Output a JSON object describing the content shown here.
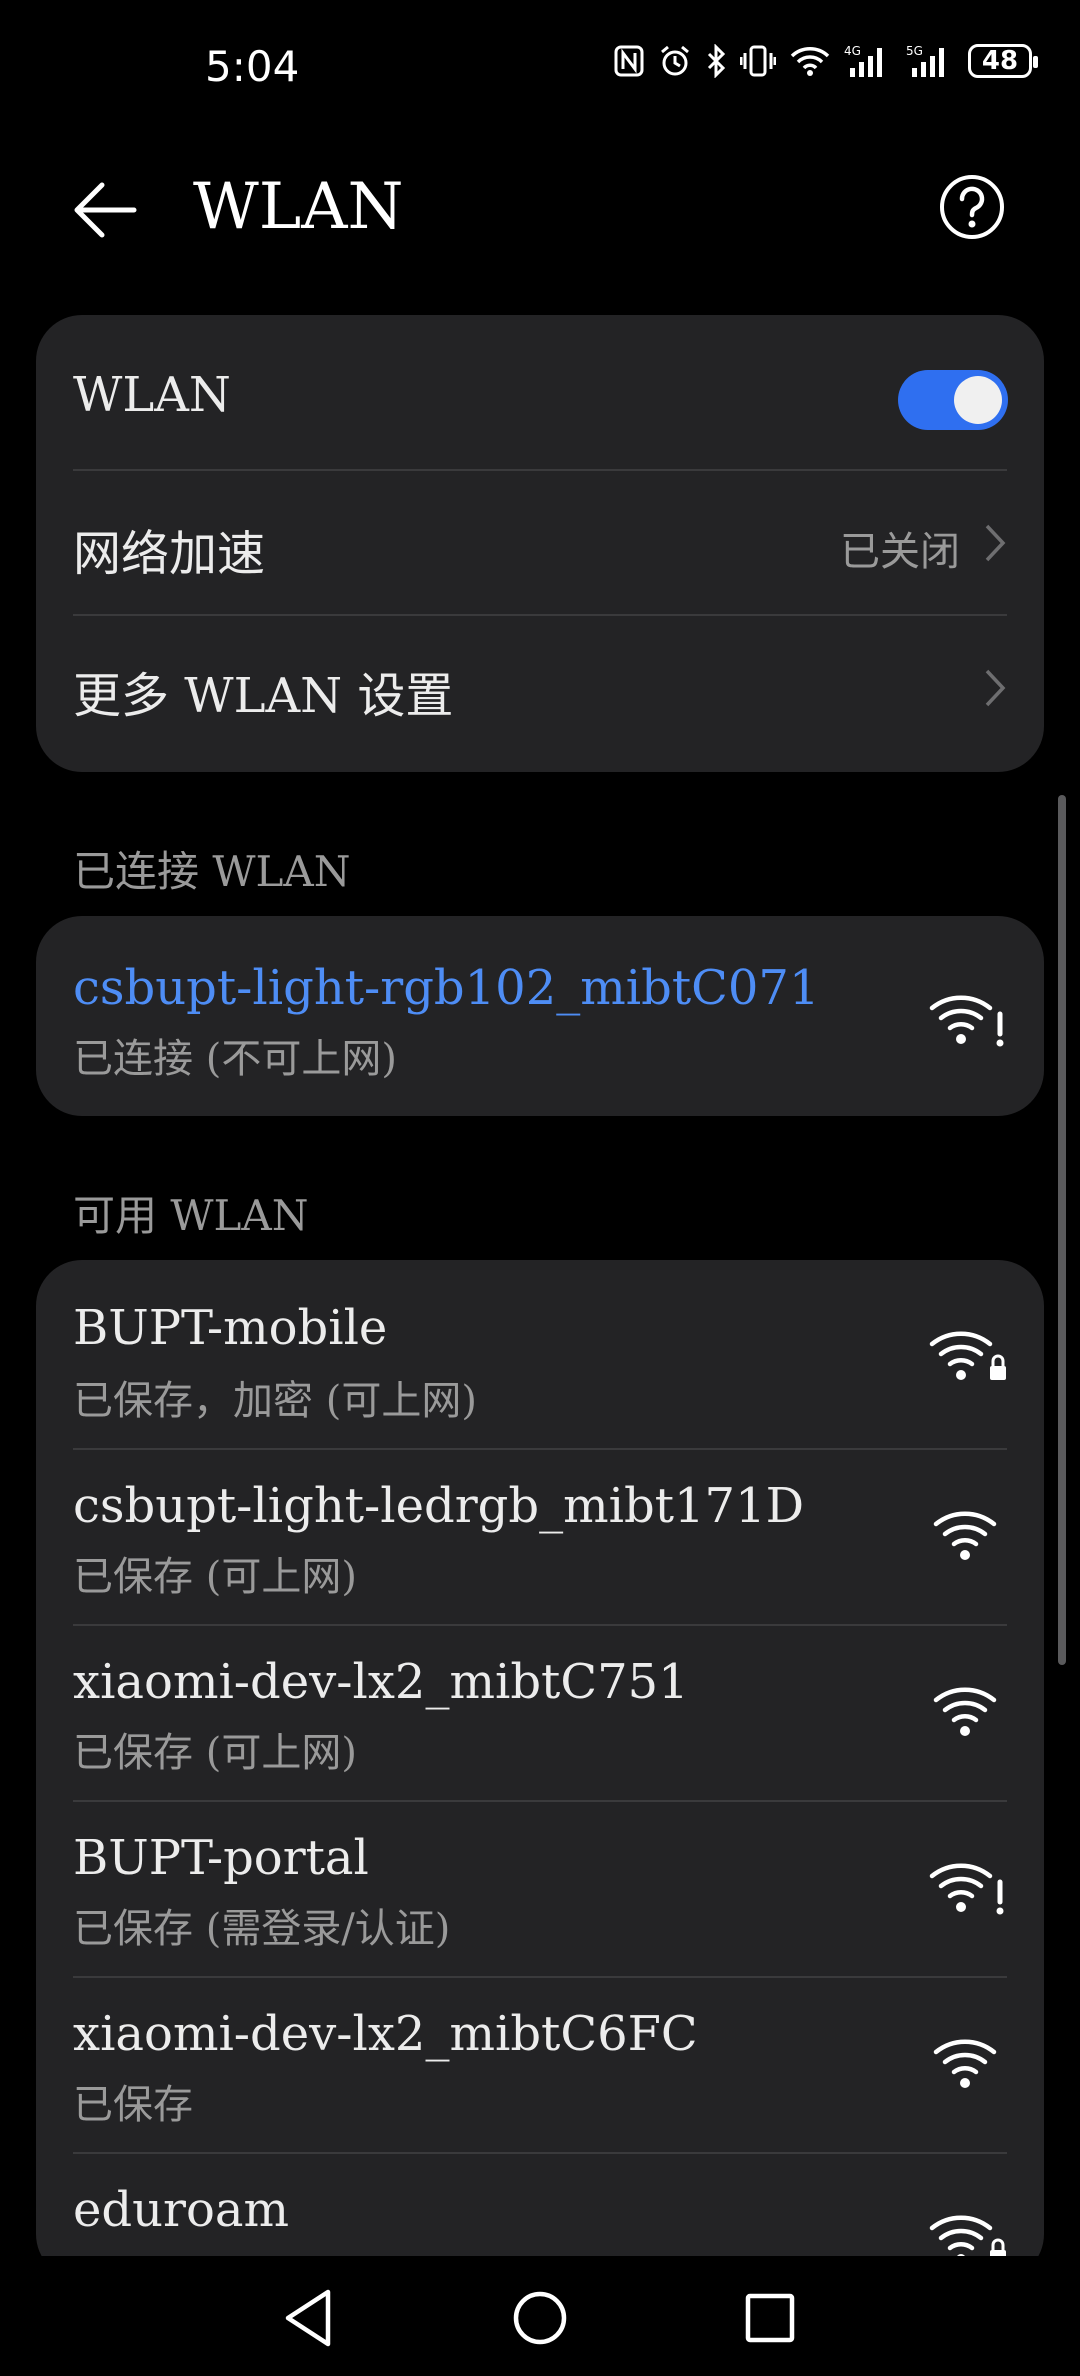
{
  "status": {
    "time": "5:04",
    "battery": "48",
    "icons": [
      "nfc-icon",
      "alarm-icon",
      "bluetooth-icon",
      "vibrate-icon",
      "wifi-icon",
      "signal-4g-icon",
      "signal-5g-icon"
    ]
  },
  "header": {
    "title": "WLAN",
    "back_icon": "back-arrow-icon",
    "help_icon": "help-icon"
  },
  "settings": {
    "wlan_label": "WLAN",
    "wlan_on": true,
    "accel_label": "网络加速",
    "accel_value": "已关闭",
    "more_label": "更多 WLAN 设置"
  },
  "connected": {
    "section_label": "已连接 WLAN",
    "name": "csbupt-light-rgb102_mibtC071",
    "status": "已连接 (不可上网)",
    "name_color": "#4e8df5"
  },
  "available": {
    "section_label": "可用 WLAN",
    "networks": [
      {
        "name": "BUPT-mobile",
        "status": "已保存，加密 (可上网)",
        "icon": "wifi-lock-icon"
      },
      {
        "name": "csbupt-light-ledrgb_mibt171D",
        "status": "已保存 (可上网)",
        "icon": "wifi-icon"
      },
      {
        "name": "xiaomi-dev-lx2_mibtC751",
        "status": "已保存 (可上网)",
        "icon": "wifi-icon"
      },
      {
        "name": "BUPT-portal",
        "status": "已保存 (需登录/认证)",
        "icon": "wifi-alert-icon"
      },
      {
        "name": "xiaomi-dev-lx2_mibtC6FC",
        "status": "已保存",
        "icon": "wifi-icon"
      },
      {
        "name": "eduroam",
        "status": "",
        "icon": "wifi-lock-icon"
      }
    ]
  },
  "colors": {
    "accent": "#2f6ff0",
    "card_bg": "#232325",
    "background": "#000000"
  }
}
